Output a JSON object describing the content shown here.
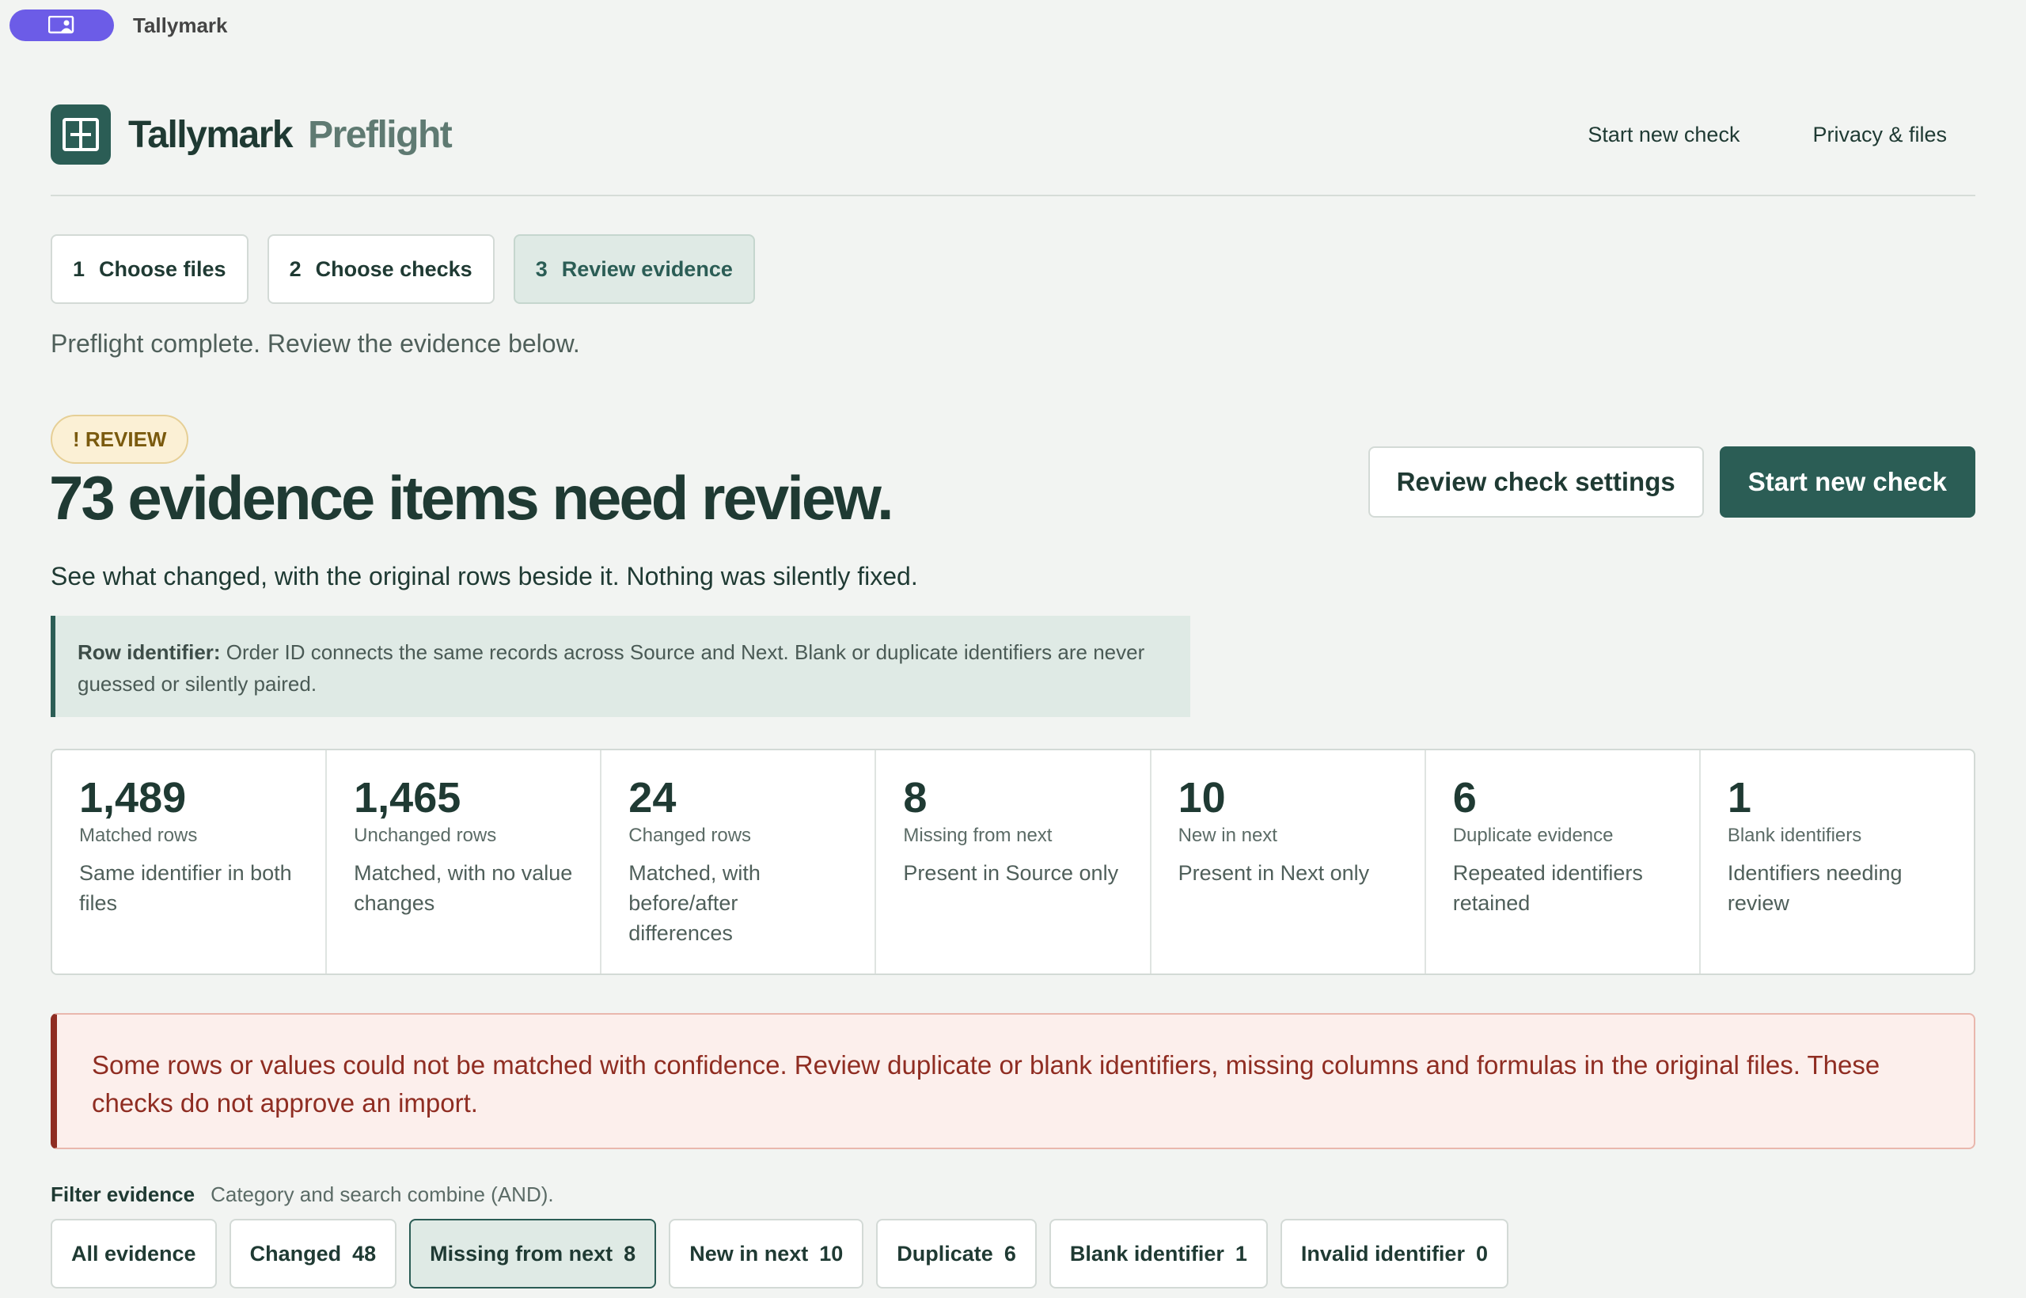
{
  "app": {
    "name": "Tallymark",
    "icon": "remote-desktop-icon"
  },
  "header": {
    "brand": "Tallymark",
    "brand_sub": "Preflight",
    "logo_icon": "book-split-icon",
    "nav": [
      {
        "label": "Start new check"
      },
      {
        "label": "Privacy & files"
      }
    ]
  },
  "steps": [
    {
      "num": "1",
      "label": "Choose files",
      "active": false
    },
    {
      "num": "2",
      "label": "Choose checks",
      "active": false
    },
    {
      "num": "3",
      "label": "Review evidence",
      "active": true
    }
  ],
  "status_line": "Preflight complete. Review the evidence below.",
  "result": {
    "badge": "! REVIEW",
    "headline": "73 evidence items need review.",
    "subline": "See what changed, with the original rows beside it. Nothing was silently fixed.",
    "actions": {
      "secondary": "Review check settings",
      "primary": "Start new check"
    }
  },
  "note": {
    "label": "Row identifier:",
    "text": " Order ID connects the same records across Source and Next. Blank or duplicate identifiers are never guessed or silently paired."
  },
  "stats": [
    {
      "value": "1,489",
      "label": "Matched rows",
      "desc": "Same identifier in both files"
    },
    {
      "value": "1,465",
      "label": "Unchanged rows",
      "desc": "Matched, with no value changes"
    },
    {
      "value": "24",
      "label": "Changed rows",
      "desc": "Matched, with before/after differences"
    },
    {
      "value": "8",
      "label": "Missing from next",
      "desc": "Present in Source only"
    },
    {
      "value": "10",
      "label": "New in next",
      "desc": "Present in Next only"
    },
    {
      "value": "6",
      "label": "Duplicate evidence",
      "desc": "Repeated identifiers retained"
    },
    {
      "value": "1",
      "label": "Blank identifiers",
      "desc": "Identifiers needing review"
    }
  ],
  "alert": "Some rows or values could not be matched with confidence. Review duplicate or blank identifiers, missing columns and formulas in the original files. These checks do not approve an import.",
  "filter": {
    "title": "Filter evidence",
    "hint": "Category and search combine (AND).",
    "chips": [
      {
        "label": "All evidence",
        "count": "",
        "active": false
      },
      {
        "label": "Changed",
        "count": "48",
        "active": false
      },
      {
        "label": "Missing from next",
        "count": "8",
        "active": true
      },
      {
        "label": "New in next",
        "count": "10",
        "active": false
      },
      {
        "label": "Duplicate",
        "count": "6",
        "active": false
      },
      {
        "label": "Blank identifier",
        "count": "1",
        "active": false
      },
      {
        "label": "Invalid identifier",
        "count": "0",
        "active": false
      }
    ]
  },
  "colors": {
    "accent": "#2b5d55",
    "app_pill": "#6c5ce7",
    "alert_text": "#8f2d22",
    "badge_bg": "#fbf0d5"
  }
}
